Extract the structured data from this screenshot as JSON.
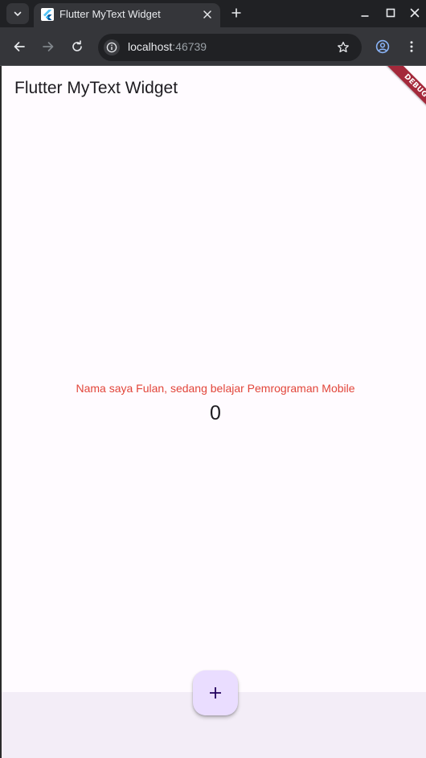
{
  "browser": {
    "tab": {
      "title": "Flutter MyText Widget",
      "favicon": "flutter-icon"
    },
    "address": {
      "host": "localhost",
      "port": ":46739"
    },
    "icons": {
      "tab_search": "chevron-down-icon",
      "tab_close": "close-icon",
      "new_tab": "plus-icon",
      "minimize": "minimize-icon",
      "maximize": "maximize-icon",
      "window_close": "close-icon",
      "back": "back-arrow-icon",
      "forward": "forward-arrow-icon",
      "reload": "reload-icon",
      "site_info": "info-icon",
      "bookmark": "star-icon",
      "profile": "profile-icon",
      "menu": "more-vert-icon"
    },
    "colors": {
      "frame": "#202124",
      "toolbar": "#35363a",
      "omnibox": "#202124",
      "profile_accent": "#8ab4f8"
    }
  },
  "app": {
    "appbar": {
      "title": "Flutter MyText Widget"
    },
    "debug_banner": "DEBUG",
    "body": {
      "text": "Nama saya Fulan, sedang belajar Pemrograman Mobile",
      "counter": "0"
    },
    "fab": {
      "icon": "plus-icon"
    },
    "colors": {
      "background": "#fffbff",
      "text_accent": "#e2453a",
      "fab": "#eaddff",
      "bottom_area": "#f3edf7",
      "debug_banner": "#a4293b"
    }
  }
}
